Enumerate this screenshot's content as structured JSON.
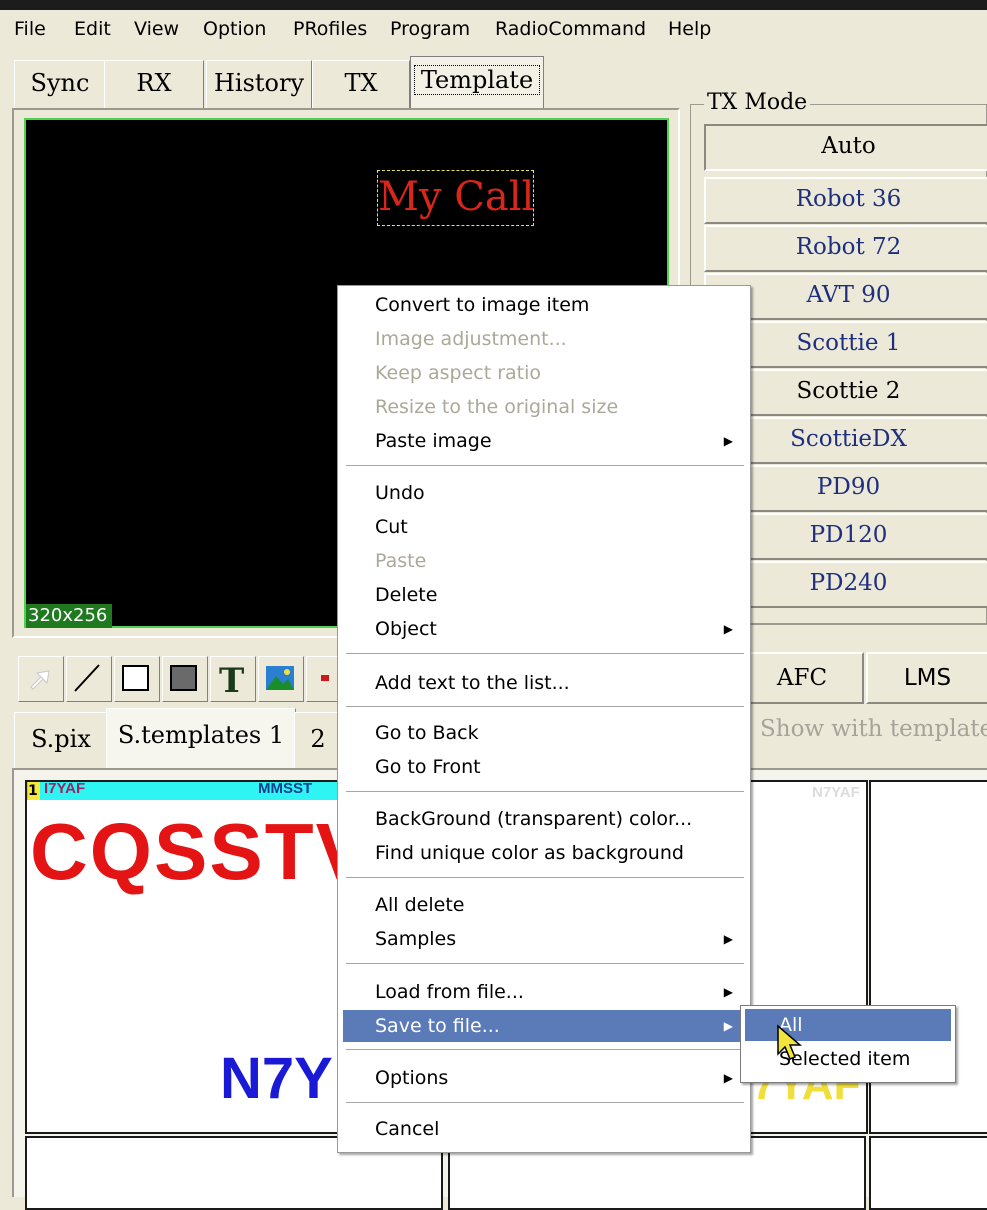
{
  "menubar": {
    "items": [
      "File",
      "Edit",
      "View",
      "Option",
      "PRofiles",
      "Program",
      "RadioCommand",
      "Help"
    ]
  },
  "tabs": {
    "sync": "Sync",
    "rx": "RX",
    "history": "History",
    "tx": "TX",
    "template": "Template"
  },
  "canvas": {
    "text_item": "My Call",
    "size": "320x256"
  },
  "tx_mode": {
    "legend": "TX Mode",
    "modes": [
      "Auto",
      "Robot 36",
      "Robot 72",
      "AVT 90",
      "Scottie 1",
      "Scottie 2",
      "ScottieDX",
      "PD90",
      "PD120",
      "PD240"
    ],
    "pressed": "Auto"
  },
  "controls": {
    "afc": "AFC",
    "lms": "LMS",
    "show_with_template": "Show with template"
  },
  "bottom_tabs": {
    "spix": "S.pix",
    "stemplates": "S.templates 1",
    "two": "2"
  },
  "gallery": {
    "thumb1": {
      "number": "1",
      "call": "I7YAF",
      "mode": "MMSST",
      "headline": "CQSSTV",
      "callsign": "N7Y"
    },
    "thumb2": {
      "call": "N7YAF",
      "callsign": "7YAF"
    }
  },
  "context_menu": {
    "items": {
      "convert": "Convert to image item",
      "image_adjustment": "Image adjustment...",
      "keep_aspect": "Keep aspect ratio",
      "resize_original": "Resize to the original size",
      "paste_image": "Paste image",
      "undo": "Undo",
      "cut": "Cut",
      "paste": "Paste",
      "delete": "Delete",
      "object": "Object",
      "add_text": "Add text to the list...",
      "go_back": "Go to Back",
      "go_front": "Go to Front",
      "bg_color": "BackGround (transparent) color...",
      "find_unique": "Find unique color as background",
      "all_delete": "All delete",
      "samples": "Samples",
      "load_file": "Load from file...",
      "save_file": "Save to file...",
      "options": "Options",
      "cancel": "Cancel"
    },
    "highlighted": "Save to file..."
  },
  "submenu": {
    "all": "All",
    "selected_item": "Selected item",
    "highlighted": "All"
  },
  "colors": {
    "menu_highlight": "#5b7bb8",
    "window_bg": "#ece9d8",
    "canvas_border": "#4fd24f",
    "mycall_text": "#d8261a",
    "mode_text": "#1f2f80"
  }
}
